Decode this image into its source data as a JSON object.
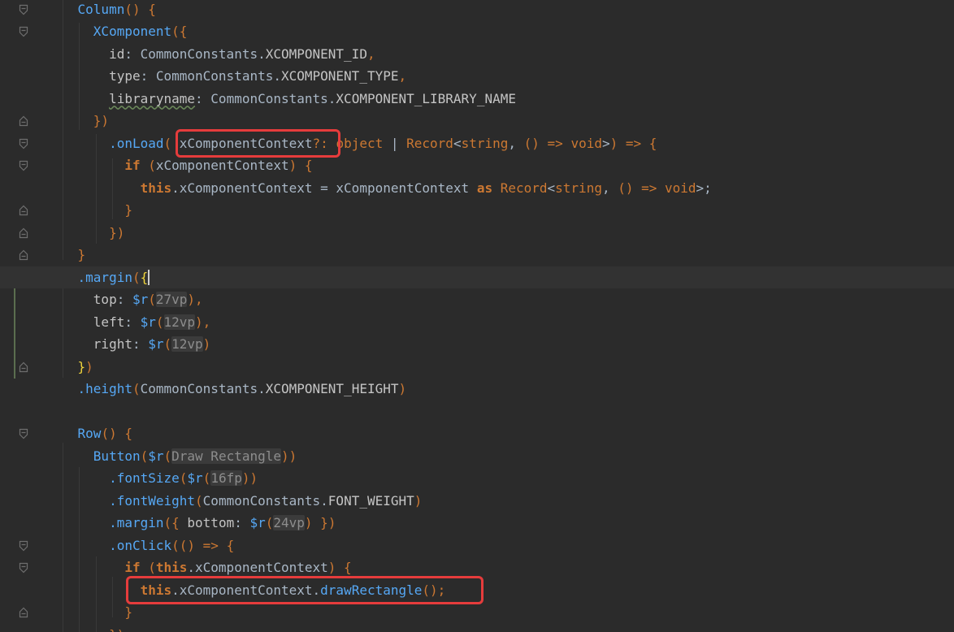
{
  "colors": {
    "background": "#2b2b2b",
    "current_line": "#323232",
    "default_text": "#a9b7c6",
    "keyword": "#cc7832",
    "method": "#56a8f5",
    "component": "#56a8f5",
    "property": "#c4c4c4",
    "constant": "#c4c4c4",
    "type_name": "#cc7832",
    "placeholder": "#8d8d8d",
    "highlight_border": "#e63c3c",
    "bracket_match": "#f0d53c"
  },
  "highlights": [
    {
      "name": "xcomponentcontext-param-highlight",
      "line_index": 6
    },
    {
      "name": "draw-rectangle-call-highlight",
      "line_index": 26
    }
  ],
  "lines": [
    {
      "tokens": [
        {
          "t": "    ",
          "c": "d"
        },
        {
          "t": "Column",
          "c": "comp"
        },
        {
          "t": "() {",
          "c": "brk"
        }
      ]
    },
    {
      "tokens": [
        {
          "t": "      ",
          "c": "d"
        },
        {
          "t": "XComponent",
          "c": "comp"
        },
        {
          "t": "({",
          "c": "brk"
        }
      ]
    },
    {
      "tokens": [
        {
          "t": "        ",
          "c": "d"
        },
        {
          "t": "id",
          "c": "prop"
        },
        {
          "t": ": CommonConstants.",
          "c": "d"
        },
        {
          "t": "XCOMPONENT_ID",
          "c": "const"
        },
        {
          "t": ",",
          "c": "kw"
        }
      ]
    },
    {
      "tokens": [
        {
          "t": "        ",
          "c": "d"
        },
        {
          "t": "type",
          "c": "prop"
        },
        {
          "t": ": CommonConstants.",
          "c": "d"
        },
        {
          "t": "XCOMPONENT_TYPE",
          "c": "const"
        },
        {
          "t": ",",
          "c": "kw"
        }
      ]
    },
    {
      "tokens": [
        {
          "t": "        ",
          "c": "d"
        },
        {
          "t": "libraryname",
          "c": "prop-wavy"
        },
        {
          "t": ": CommonConstants.",
          "c": "d"
        },
        {
          "t": "XCOMPONENT_LIBRARY_NAME",
          "c": "const"
        }
      ]
    },
    {
      "tokens": [
        {
          "t": "      ",
          "c": "d"
        },
        {
          "t": "})",
          "c": "brk"
        }
      ]
    },
    {
      "tokens": [
        {
          "t": "        ",
          "c": "d"
        },
        {
          "t": ".onLoad",
          "c": "meth"
        },
        {
          "t": "(",
          "c": "brk"
        },
        {
          "t": " xComponentContext",
          "c": "d"
        },
        {
          "t": "?: ",
          "c": "kw"
        },
        {
          "t": "object",
          "c": "type"
        },
        {
          "t": " | ",
          "c": "d"
        },
        {
          "t": "Record",
          "c": "type"
        },
        {
          "t": "<",
          "c": "d"
        },
        {
          "t": "string",
          "c": "type"
        },
        {
          "t": ", ",
          "c": "d"
        },
        {
          "t": "()",
          "c": "brk"
        },
        {
          "t": " => ",
          "c": "kw"
        },
        {
          "t": "void",
          "c": "type"
        },
        {
          "t": ">",
          "c": "d"
        },
        {
          "t": ")",
          "c": "brk"
        },
        {
          "t": " => ",
          "c": "kw"
        },
        {
          "t": "{",
          "c": "brk"
        }
      ]
    },
    {
      "tokens": [
        {
          "t": "          ",
          "c": "d"
        },
        {
          "t": "if",
          "c": "kwb"
        },
        {
          "t": " (",
          "c": "brk"
        },
        {
          "t": "xComponentContext",
          "c": "d"
        },
        {
          "t": ")",
          "c": "brk"
        },
        {
          "t": " {",
          "c": "brk"
        }
      ]
    },
    {
      "tokens": [
        {
          "t": "            ",
          "c": "d"
        },
        {
          "t": "this",
          "c": "kwb"
        },
        {
          "t": ".xComponentContext = xComponentContext ",
          "c": "d"
        },
        {
          "t": "as",
          "c": "kwb"
        },
        {
          "t": " ",
          "c": "d"
        },
        {
          "t": "Record",
          "c": "type"
        },
        {
          "t": "<",
          "c": "d"
        },
        {
          "t": "string",
          "c": "type"
        },
        {
          "t": ", ",
          "c": "d"
        },
        {
          "t": "()",
          "c": "brk"
        },
        {
          "t": " => ",
          "c": "kw"
        },
        {
          "t": "void",
          "c": "type"
        },
        {
          "t": ">;",
          "c": "d"
        }
      ]
    },
    {
      "tokens": [
        {
          "t": "          ",
          "c": "d"
        },
        {
          "t": "}",
          "c": "brk"
        }
      ]
    },
    {
      "tokens": [
        {
          "t": "        ",
          "c": "d"
        },
        {
          "t": "})",
          "c": "brk"
        }
      ]
    },
    {
      "tokens": [
        {
          "t": "    ",
          "c": "d"
        },
        {
          "t": "}",
          "c": "brk"
        }
      ]
    },
    {
      "tokens": [
        {
          "t": "    ",
          "c": "d"
        },
        {
          "t": ".margin",
          "c": "meth"
        },
        {
          "t": "(",
          "c": "brk"
        },
        {
          "t": "{",
          "c": "match"
        },
        {
          "t": "",
          "c": "caret"
        }
      ],
      "current": true
    },
    {
      "tokens": [
        {
          "t": "      ",
          "c": "d"
        },
        {
          "t": "top",
          "c": "prop"
        },
        {
          "t": ": ",
          "c": "d"
        },
        {
          "t": "$r",
          "c": "meth"
        },
        {
          "t": "(",
          "c": "brk"
        },
        {
          "t": "27vp",
          "c": "ph"
        },
        {
          "t": ")",
          "c": "brk"
        },
        {
          "t": ",",
          "c": "kw"
        }
      ]
    },
    {
      "tokens": [
        {
          "t": "      ",
          "c": "d"
        },
        {
          "t": "left",
          "c": "prop"
        },
        {
          "t": ": ",
          "c": "d"
        },
        {
          "t": "$r",
          "c": "meth"
        },
        {
          "t": "(",
          "c": "brk"
        },
        {
          "t": "12vp",
          "c": "ph"
        },
        {
          "t": ")",
          "c": "brk"
        },
        {
          "t": ",",
          "c": "kw"
        }
      ]
    },
    {
      "tokens": [
        {
          "t": "      ",
          "c": "d"
        },
        {
          "t": "right",
          "c": "prop"
        },
        {
          "t": ": ",
          "c": "d"
        },
        {
          "t": "$r",
          "c": "meth"
        },
        {
          "t": "(",
          "c": "brk"
        },
        {
          "t": "12vp",
          "c": "ph"
        },
        {
          "t": ")",
          "c": "brk"
        }
      ]
    },
    {
      "tokens": [
        {
          "t": "    ",
          "c": "d"
        },
        {
          "t": "}",
          "c": "match"
        },
        {
          "t": ")",
          "c": "brk"
        }
      ]
    },
    {
      "tokens": [
        {
          "t": "    ",
          "c": "d"
        },
        {
          "t": ".height",
          "c": "meth"
        },
        {
          "t": "(",
          "c": "brk"
        },
        {
          "t": "CommonConstants.",
          "c": "d"
        },
        {
          "t": "XCOMPONENT_HEIGHT",
          "c": "const"
        },
        {
          "t": ")",
          "c": "brk"
        }
      ]
    },
    {
      "tokens": []
    },
    {
      "tokens": [
        {
          "t": "    ",
          "c": "d"
        },
        {
          "t": "Row",
          "c": "comp"
        },
        {
          "t": "() {",
          "c": "brk"
        }
      ]
    },
    {
      "tokens": [
        {
          "t": "      ",
          "c": "d"
        },
        {
          "t": "Button",
          "c": "comp"
        },
        {
          "t": "(",
          "c": "brk"
        },
        {
          "t": "$r",
          "c": "meth"
        },
        {
          "t": "(",
          "c": "brk"
        },
        {
          "t": "Draw Rectangle",
          "c": "ph"
        },
        {
          "t": "))",
          "c": "brk"
        }
      ]
    },
    {
      "tokens": [
        {
          "t": "        ",
          "c": "d"
        },
        {
          "t": ".fontSize",
          "c": "meth"
        },
        {
          "t": "(",
          "c": "brk"
        },
        {
          "t": "$r",
          "c": "meth"
        },
        {
          "t": "(",
          "c": "brk"
        },
        {
          "t": "16fp",
          "c": "ph"
        },
        {
          "t": "))",
          "c": "brk"
        }
      ]
    },
    {
      "tokens": [
        {
          "t": "        ",
          "c": "d"
        },
        {
          "t": ".fontWeight",
          "c": "meth"
        },
        {
          "t": "(",
          "c": "brk"
        },
        {
          "t": "CommonConstants.",
          "c": "d"
        },
        {
          "t": "FONT_WEIGHT",
          "c": "const"
        },
        {
          "t": ")",
          "c": "brk"
        }
      ]
    },
    {
      "tokens": [
        {
          "t": "        ",
          "c": "d"
        },
        {
          "t": ".margin",
          "c": "meth"
        },
        {
          "t": "(",
          "c": "brk"
        },
        {
          "t": "{ ",
          "c": "brk"
        },
        {
          "t": "bottom",
          "c": "prop"
        },
        {
          "t": ": ",
          "c": "d"
        },
        {
          "t": "$r",
          "c": "meth"
        },
        {
          "t": "(",
          "c": "brk"
        },
        {
          "t": "24vp",
          "c": "ph"
        },
        {
          "t": ")",
          "c": "brk"
        },
        {
          "t": " })",
          "c": "brk"
        }
      ]
    },
    {
      "tokens": [
        {
          "t": "        ",
          "c": "d"
        },
        {
          "t": ".onClick",
          "c": "meth"
        },
        {
          "t": "((",
          "c": "brk"
        },
        {
          "t": ")",
          "c": "brk"
        },
        {
          "t": " => ",
          "c": "kw"
        },
        {
          "t": "{",
          "c": "brk"
        }
      ]
    },
    {
      "tokens": [
        {
          "t": "          ",
          "c": "d"
        },
        {
          "t": "if",
          "c": "kwb"
        },
        {
          "t": " (",
          "c": "brk"
        },
        {
          "t": "this",
          "c": "kwb"
        },
        {
          "t": ".xComponentContext",
          "c": "d"
        },
        {
          "t": ")",
          "c": "brk"
        },
        {
          "t": " {",
          "c": "brk"
        }
      ]
    },
    {
      "tokens": [
        {
          "t": "            ",
          "c": "d"
        },
        {
          "t": "this",
          "c": "kwb"
        },
        {
          "t": ".xComponentContext.",
          "c": "d"
        },
        {
          "t": "drawRectangle",
          "c": "meth"
        },
        {
          "t": "()",
          "c": "brk"
        },
        {
          "t": ";",
          "c": "kw"
        }
      ]
    },
    {
      "tokens": [
        {
          "t": "          ",
          "c": "d"
        },
        {
          "t": "}",
          "c": "brk"
        }
      ]
    },
    {
      "tokens": [
        {
          "t": "        ",
          "c": "d"
        },
        {
          "t": "})",
          "c": "brk"
        }
      ]
    }
  ]
}
